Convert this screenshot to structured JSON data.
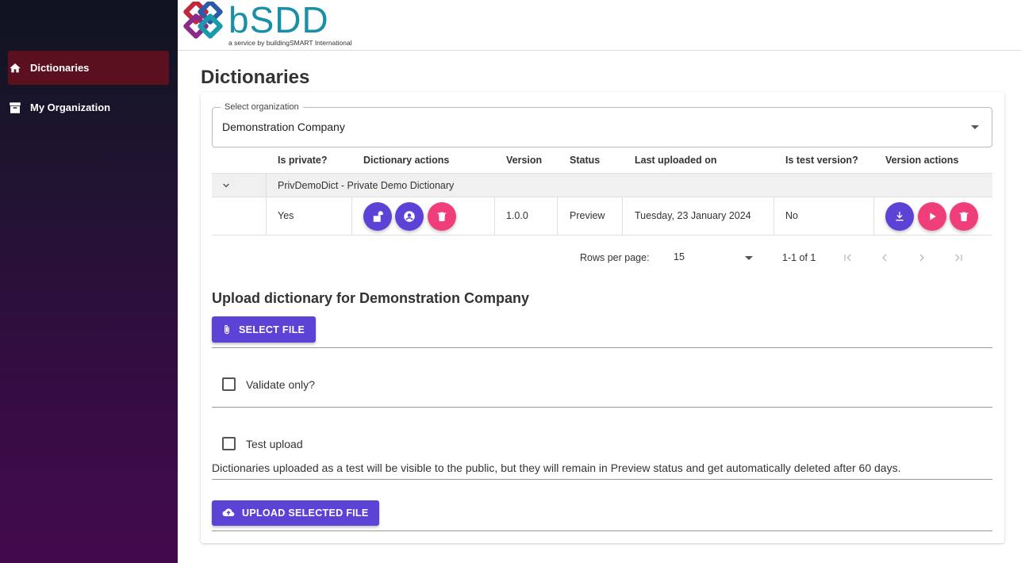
{
  "sidebar": {
    "items": [
      {
        "label": "Dictionaries",
        "icon": "home-icon",
        "active": true
      },
      {
        "label": "My Organization",
        "icon": "archive-icon",
        "active": false
      }
    ]
  },
  "header": {
    "logo_text": "bSDD",
    "logo_sub": "a service by buildingSMART International"
  },
  "page": {
    "title": "Dictionaries"
  },
  "org_select": {
    "legend": "Select organization",
    "value": "Demonstration Company"
  },
  "table": {
    "headers": [
      "Is private?",
      "Dictionary actions",
      "Version",
      "Status",
      "Last uploaded on",
      "Is test version?",
      "Version actions"
    ],
    "group_label": "PrivDemoDict - Private Demo Dictionary",
    "row": {
      "is_private": "Yes",
      "version": "1.0.0",
      "status": "Preview",
      "last_uploaded": "Tuesday, 23 January 2024",
      "is_test": "No"
    }
  },
  "pager": {
    "rows_label": "Rows per page:",
    "rows_value": "15",
    "range": "1-1 of 1"
  },
  "upload": {
    "title": "Upload dictionary for Demonstration Company",
    "select_file_label": "SELECT FILE",
    "validate_only_label": "Validate only?",
    "test_upload_label": "Test upload",
    "test_note": "Dictionaries uploaded as a test will be visible to the public, but they will remain in Preview status and get automatically deleted after 60 days.",
    "upload_label": "UPLOAD SELECTED FILE"
  },
  "colors": {
    "accent": "#5c43d6",
    "danger": "#f03e7a",
    "active_nav": "#5b1020"
  }
}
